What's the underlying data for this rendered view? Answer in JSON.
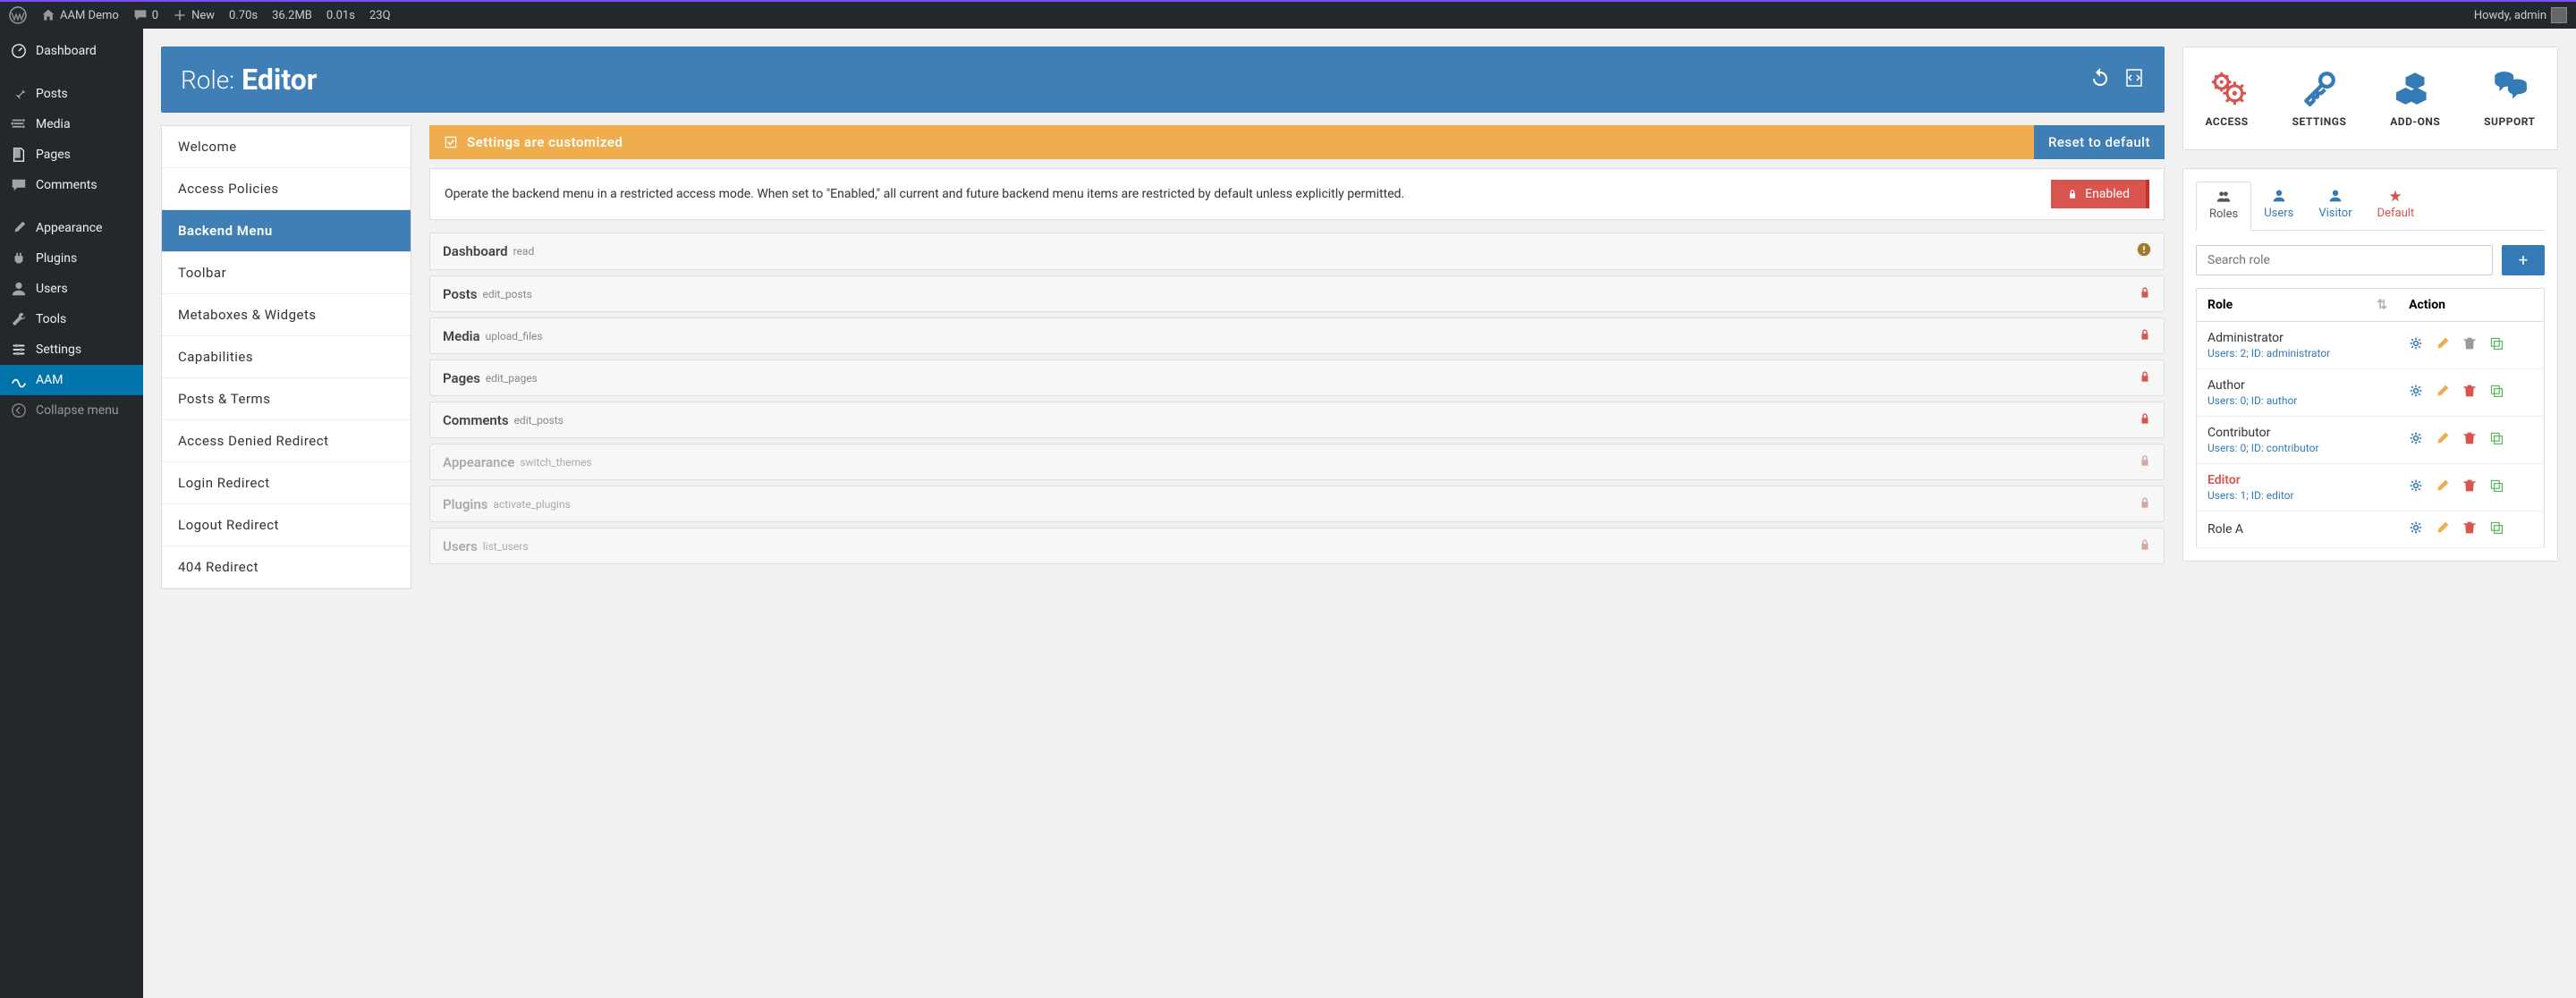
{
  "topbar": {
    "site": "AAM Demo",
    "comments": "0",
    "new": "New",
    "stats": [
      "0.70s",
      "36.2MB",
      "0.01s",
      "23Q"
    ],
    "howdy": "Howdy, admin"
  },
  "sidebar": {
    "items": [
      {
        "label": "Dashboard",
        "icon": "dashboard"
      },
      {
        "label": "Posts",
        "icon": "pin"
      },
      {
        "label": "Media",
        "icon": "media"
      },
      {
        "label": "Pages",
        "icon": "page"
      },
      {
        "label": "Comments",
        "icon": "comment"
      },
      {
        "label": "Appearance",
        "icon": "brush"
      },
      {
        "label": "Plugins",
        "icon": "plugin"
      },
      {
        "label": "Users",
        "icon": "user"
      },
      {
        "label": "Tools",
        "icon": "wrench"
      },
      {
        "label": "Settings",
        "icon": "sliders"
      },
      {
        "label": "AAM",
        "icon": "aam",
        "active": true
      }
    ],
    "collapse": "Collapse menu"
  },
  "role_header": {
    "label": "Role:",
    "name": "Editor"
  },
  "feature_tabs": [
    "Welcome",
    "Access Policies",
    "Backend Menu",
    "Toolbar",
    "Metaboxes & Widgets",
    "Capabilities",
    "Posts & Terms",
    "Access Denied Redirect",
    "Login Redirect",
    "Logout Redirect",
    "404 Redirect"
  ],
  "feature_active_index": 2,
  "banner": {
    "text": "Settings are customized",
    "reset": "Reset to default"
  },
  "restrict": {
    "text": "Operate the backend menu in a restricted access mode. When set to \"Enabled,\" all current and future backend menu items are restricted by default unless explicitly permitted.",
    "button": "Enabled"
  },
  "menu_items": [
    {
      "title": "Dashboard",
      "cap": "read",
      "status": "warn"
    },
    {
      "title": "Posts",
      "cap": "edit_posts",
      "status": "lock"
    },
    {
      "title": "Media",
      "cap": "upload_files",
      "status": "lock"
    },
    {
      "title": "Pages",
      "cap": "edit_pages",
      "status": "lock"
    },
    {
      "title": "Comments",
      "cap": "edit_posts",
      "status": "lock"
    },
    {
      "title": "Appearance",
      "cap": "switch_themes",
      "status": "lock",
      "disabled": true
    },
    {
      "title": "Plugins",
      "cap": "activate_plugins",
      "status": "lock",
      "disabled": true
    },
    {
      "title": "Users",
      "cap": "list_users",
      "status": "lock",
      "disabled": true
    }
  ],
  "rc_tabs": [
    {
      "label": "ACCESS",
      "color": "#d9534f"
    },
    {
      "label": "SETTINGS",
      "color": "#337ab7"
    },
    {
      "label": "ADD-ONS",
      "color": "#337ab7"
    },
    {
      "label": "SUPPORT",
      "color": "#337ab7"
    }
  ],
  "subject_tabs": [
    {
      "label": "Roles",
      "cls": "roles",
      "active": true
    },
    {
      "label": "Users",
      "cls": "users"
    },
    {
      "label": "Visitor",
      "cls": "visitor"
    },
    {
      "label": "Default",
      "cls": "default"
    }
  ],
  "search_placeholder": "Search role",
  "table": {
    "headers": [
      "Role",
      "Action"
    ],
    "rows": [
      {
        "name": "Administrator",
        "users": "2",
        "id": "administrator",
        "del_muted": true
      },
      {
        "name": "Author",
        "users": "0",
        "id": "author"
      },
      {
        "name": "Contributor",
        "users": "0",
        "id": "contributor"
      },
      {
        "name": "Editor",
        "users": "1",
        "id": "editor",
        "current": true
      },
      {
        "name": "Role A",
        "users": "",
        "id": ""
      }
    ],
    "meta_users": "Users:",
    "meta_id": "ID:"
  }
}
